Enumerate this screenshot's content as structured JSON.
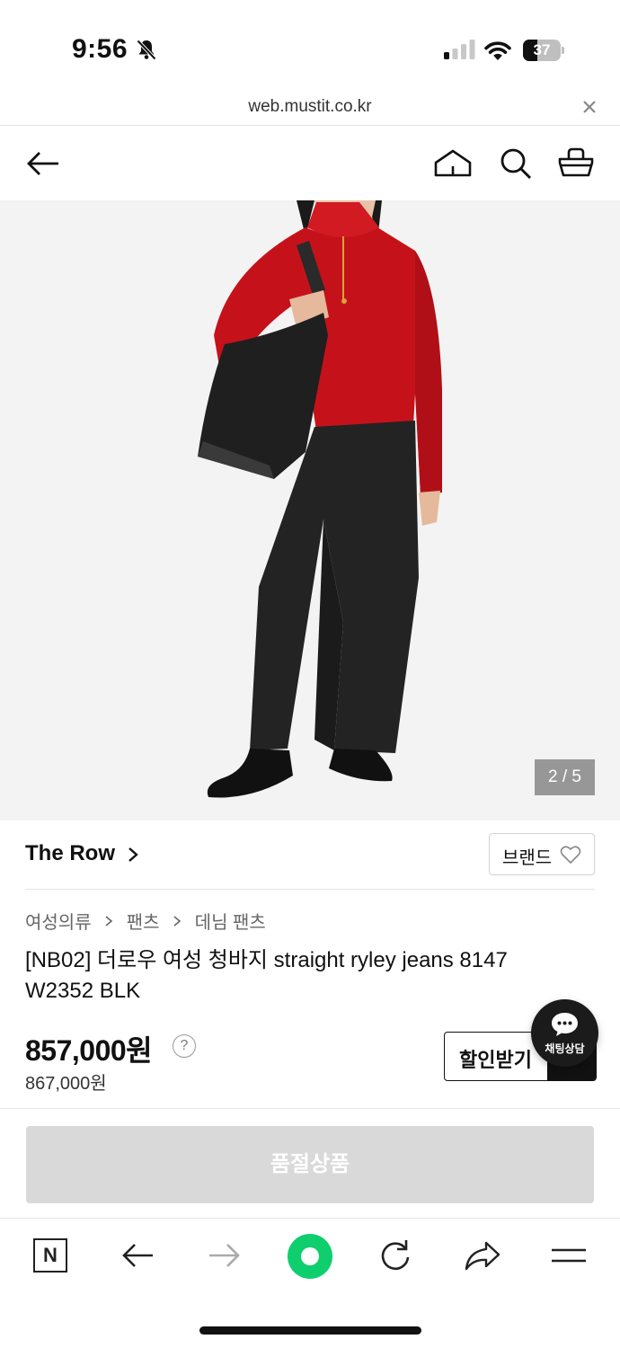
{
  "status_bar": {
    "time": "9:56",
    "battery": "37",
    "battery_level": 0.37
  },
  "browser": {
    "url": "web.mustit.co.kr"
  },
  "header": {
    "icons": [
      "back-arrow-icon",
      "home-icon",
      "search-icon",
      "cart-basket-icon"
    ]
  },
  "gallery": {
    "counter": "2 / 5",
    "current": 2,
    "total": 5
  },
  "brand": {
    "name": "The Row",
    "brand_button_label": "브랜드"
  },
  "category": {
    "level1": "여성의류",
    "level2": "팬츠",
    "level3": "데님 팬츠"
  },
  "product": {
    "title": "[NB02] 더로우 여성 청바지 straight ryley jeans 8147 W2352 BLK",
    "price": "857,000원",
    "original_price": "867,000원",
    "help_mark": "?"
  },
  "actions": {
    "discount_label": "할인받기",
    "chat_label": "채팅상담",
    "soldout_label": "품절상품"
  },
  "toolbar": {
    "naver_label": "N"
  },
  "colors": {
    "soldout_bg": "#d9d9d9",
    "green_accent": "#0fce6e",
    "sweater_red": "#c5121a"
  }
}
